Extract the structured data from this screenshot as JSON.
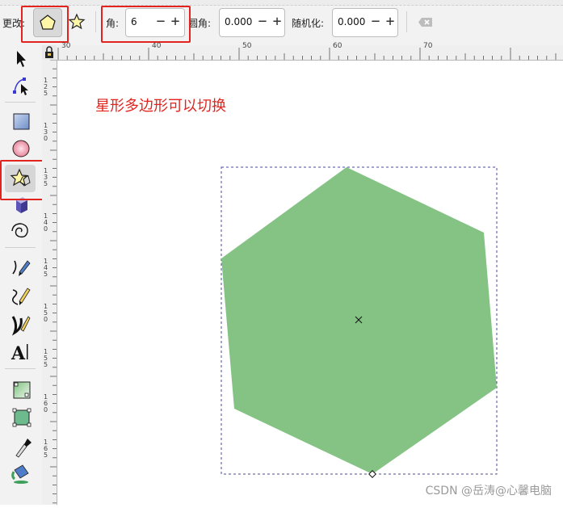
{
  "toolbar": {
    "change_label": "更改:",
    "corners_label": "角:",
    "corners_value": "6",
    "rounded_label": "圆角:",
    "rounded_value": "0.000",
    "randomized_label": "随机化:",
    "randomized_value": "0.000",
    "minus": "−",
    "plus": "+",
    "mode": "polygon"
  },
  "ruler": {
    "top_ticks": [
      "30",
      "40",
      "50",
      "60",
      "70"
    ],
    "left_ticks": [
      "1\n2\n5",
      "1\n3\n0",
      "1\n3\n5",
      "1\n4\n0",
      "1\n4\n5",
      "1\n5\n0",
      "1\n5\n5",
      "1\n6\n0",
      "1\n6\n5"
    ]
  },
  "tools": [
    {
      "icon": "selector-arrow-icon"
    },
    {
      "icon": "node-editor-icon"
    },
    {
      "icon": "rectangle-icon"
    },
    {
      "icon": "circle-icon"
    },
    {
      "icon": "star-polygon-icon",
      "active": true
    },
    {
      "icon": "box3d-icon"
    },
    {
      "icon": "spiral-icon"
    },
    {
      "icon": "pen-icon"
    },
    {
      "icon": "pencil-icon"
    },
    {
      "icon": "calligraphy-icon"
    },
    {
      "icon": "text-icon"
    },
    {
      "icon": "gradient-icon"
    },
    {
      "icon": "mesh-icon"
    },
    {
      "icon": "dropper-icon"
    },
    {
      "icon": "paint-bucket-icon"
    }
  ],
  "canvas": {
    "annotation": "星形多边形可以切换",
    "shape_color": "#84c384",
    "shape": "hexagon"
  },
  "colors": {
    "highlight": "#e3231e",
    "bbox": "#4a4a9a"
  },
  "watermark": "CSDN @岳涛@心馨电脑"
}
